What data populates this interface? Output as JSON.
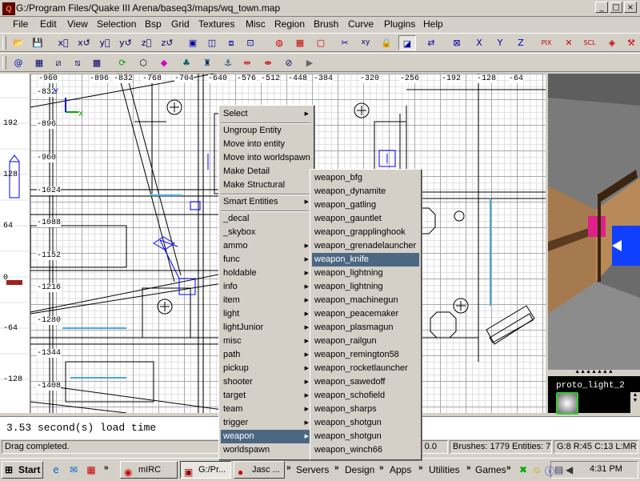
{
  "window": {
    "title": "G:/Program Files/Quake III Arena/baseq3/maps/wq_town.map",
    "icon": "radiant-app-icon",
    "controls": [
      "_",
      "□",
      "×"
    ]
  },
  "menubar": [
    "File",
    "Edit",
    "View",
    "Selection",
    "Bsp",
    "Grid",
    "Textures",
    "Misc",
    "Region",
    "Brush",
    "Curve",
    "Plugins",
    "Help"
  ],
  "zview": {
    "labels": [
      "192",
      "128",
      "64",
      "0",
      "-64",
      "-128"
    ]
  },
  "gridview": {
    "x_labels": [
      "-960",
      "-896",
      "-832",
      "-768",
      "-704",
      "-640",
      "-576",
      "-512",
      "-448",
      "-384",
      "-320",
      "-256",
      "-192",
      "-128",
      "-64"
    ],
    "y_labels": [
      "-832",
      "-896",
      "-960",
      "-1024",
      "-1088",
      "-1152",
      "-1216",
      "-1280",
      "-1344",
      "-1408"
    ],
    "axis_x": "X",
    "axis_y": "Y"
  },
  "context_menu": {
    "items": [
      {
        "label": "Select",
        "submenu": true
      },
      {
        "label": "Ungroup Entity"
      },
      {
        "label": "Move into entity"
      },
      {
        "label": "Move into worldspawn"
      },
      {
        "label": "Make Detail"
      },
      {
        "label": "Make Structural"
      },
      {
        "label": "Smart Entities",
        "submenu": true
      },
      {
        "label": "_decal"
      },
      {
        "label": "_skybox"
      },
      {
        "label": "ammo",
        "submenu": true
      },
      {
        "label": "func",
        "submenu": true
      },
      {
        "label": "holdable",
        "submenu": true
      },
      {
        "label": "info",
        "submenu": true
      },
      {
        "label": "item",
        "submenu": true
      },
      {
        "label": "light",
        "submenu": true
      },
      {
        "label": "lightJunior",
        "submenu": true
      },
      {
        "label": "misc",
        "submenu": true
      },
      {
        "label": "path",
        "submenu": true
      },
      {
        "label": "pickup",
        "submenu": true
      },
      {
        "label": "shooter",
        "submenu": true
      },
      {
        "label": "target",
        "submenu": true
      },
      {
        "label": "team",
        "submenu": true
      },
      {
        "label": "trigger",
        "submenu": true
      },
      {
        "label": "weapon",
        "submenu": true,
        "selected": true
      },
      {
        "label": "worldspawn"
      }
    ]
  },
  "weapon_submenu": {
    "items": [
      "weapon_bfg",
      "weapon_dynamite",
      "weapon_gatling",
      "weapon_gauntlet",
      "weapon_grapplinghook",
      "weapon_grenadelauncher",
      "weapon_knife",
      "weapon_lightning",
      "weapon_lightning",
      "weapon_machinegun",
      "weapon_peacemaker",
      "weapon_plasmagun",
      "weapon_railgun",
      "weapon_remington58",
      "weapon_rocketlauncher",
      "weapon_sawedoff",
      "weapon_schofield",
      "weapon_sharps",
      "weapon_shotgun",
      "weapon_shotgun",
      "weapon_winch66"
    ],
    "selected_index": 6
  },
  "texture_window": {
    "label": "proto_light_2"
  },
  "console": {
    "text": "3.53 second(s) load time"
  },
  "statusbar": {
    "message": "Drag completed.",
    "coords": "z:: 0.0",
    "counts": "Brushes: 1779 Entities: 79",
    "grid": "G:8 R:45 C:13 L:MR"
  },
  "taskbar": {
    "start": "Start",
    "tasks": [
      "mIRC",
      "G:/Pr...",
      "Jasc ..."
    ],
    "quicklaunch": [
      "Servers",
      "Design",
      "Apps",
      "Utilities",
      "Games"
    ],
    "clock": "4:31 PM"
  },
  "colors": {
    "menu_highlight": "#4c6782",
    "brush_lines": "#000000",
    "selected_entity": "#0000ff",
    "cyan_detail": "#4aa8d8"
  }
}
